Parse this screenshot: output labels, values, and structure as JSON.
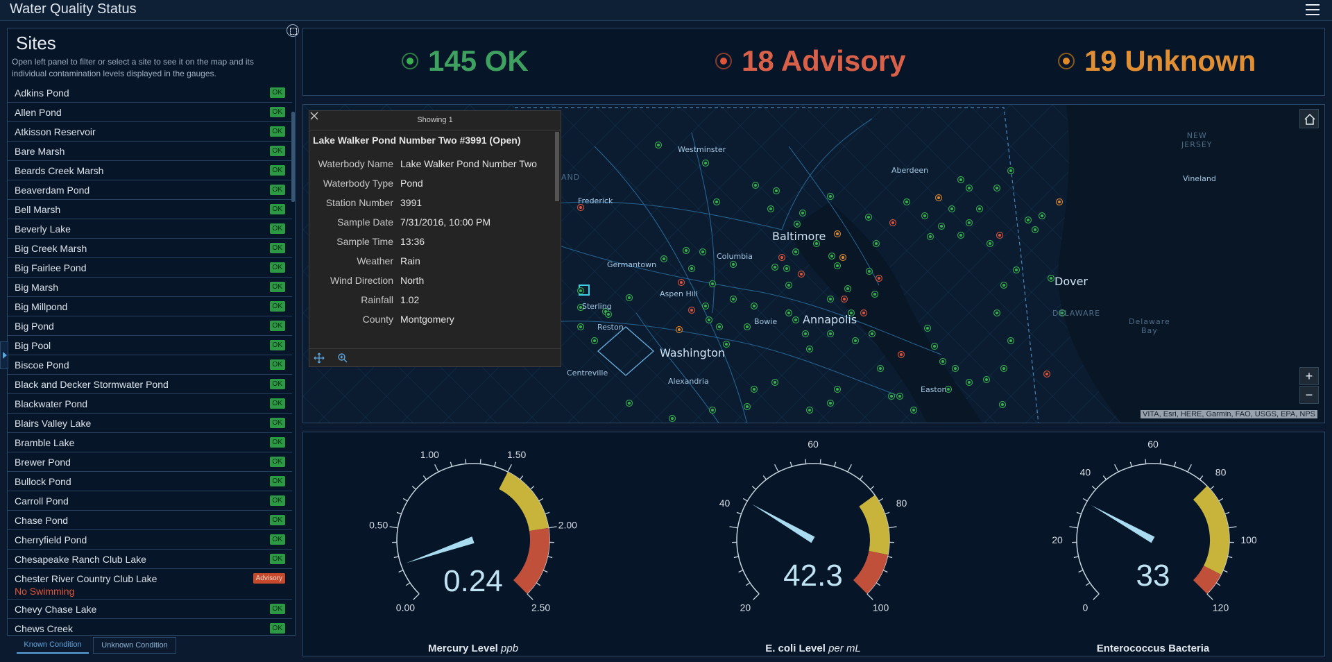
{
  "header": {
    "title": "Water Quality Status"
  },
  "sites": {
    "title": "Sites",
    "description": "Open left panel to filter or select a site to see it on the map and its individual contamination levels displayed in the gauges.",
    "items": [
      {
        "name": "Adkins Pond",
        "status": "OK"
      },
      {
        "name": "Allen Pond",
        "status": "OK"
      },
      {
        "name": "Atkisson Reservoir",
        "status": "OK"
      },
      {
        "name": "Bare Marsh",
        "status": "OK"
      },
      {
        "name": "Beards Creek Marsh",
        "status": "OK"
      },
      {
        "name": "Beaverdam Pond",
        "status": "OK"
      },
      {
        "name": "Bell Marsh",
        "status": "OK"
      },
      {
        "name": "Beverly Lake",
        "status": "OK"
      },
      {
        "name": "Big Creek Marsh",
        "status": "OK"
      },
      {
        "name": "Big Fairlee Pond",
        "status": "OK"
      },
      {
        "name": "Big Marsh",
        "status": "OK"
      },
      {
        "name": "Big Millpond",
        "status": "OK"
      },
      {
        "name": "Big Pond",
        "status": "OK"
      },
      {
        "name": "Big Pool",
        "status": "OK"
      },
      {
        "name": "Biscoe Pond",
        "status": "OK"
      },
      {
        "name": "Black and Decker Stormwater Pond",
        "status": "OK"
      },
      {
        "name": "Blackwater Pond",
        "status": "OK"
      },
      {
        "name": "Blairs Valley Lake",
        "status": "OK"
      },
      {
        "name": "Bramble Lake",
        "status": "OK"
      },
      {
        "name": "Brewer Pond",
        "status": "OK"
      },
      {
        "name": "Bullock Pond",
        "status": "OK"
      },
      {
        "name": "Carroll Pond",
        "status": "OK"
      },
      {
        "name": "Chase Pond",
        "status": "OK"
      },
      {
        "name": "Cherryfield Pond",
        "status": "OK"
      },
      {
        "name": "Chesapeake Ranch Club Lake",
        "status": "OK"
      },
      {
        "name": "Chester River Country Club Lake",
        "status": "Advisory",
        "note": "No Swimming"
      },
      {
        "name": "Chevy Chase Lake",
        "status": "OK"
      },
      {
        "name": "Chews Creek",
        "status": "OK"
      }
    ]
  },
  "tabs": {
    "known": "Known Condition",
    "unknown": "Unknown Condition"
  },
  "indicators": {
    "ok": "145 OK",
    "advisory": "18 Advisory",
    "unknown": "19 Unknown"
  },
  "map": {
    "labels": {
      "westminster": "Westminster",
      "aberdeen": "Aberdeen",
      "new_jersey": "NEW\nJERSEY",
      "vineland": "Vineland",
      "frederick": "Frederick",
      "baltimore": "Baltimore",
      "germantown": "Germantown",
      "columbia": "Columbia",
      "aspen_hill": "Aspen Hill",
      "dover": "Dover",
      "sterling": "Sterling",
      "reston": "Reston",
      "bowie": "Bowie",
      "annapolis": "Annapolis",
      "washington": "Washington",
      "delaware_bay": "Delaware\nBay",
      "delaware": "DELAWARE",
      "centreville": "Centreville",
      "alexandria": "Alexandria",
      "easton": "Easton",
      "and": "AND"
    },
    "attribution": "VITA, Esri, HERE, Garmin, FAO, USGS, EPA, NPS",
    "zoom_in": "+",
    "zoom_out": "−"
  },
  "popup": {
    "header": "Showing 1",
    "title": "Lake Walker Pond Number Two #3991 (Open)",
    "fields": [
      {
        "key": "Waterbody Name",
        "value": "Lake Walker Pond Number Two"
      },
      {
        "key": "Waterbody Type",
        "value": "Pond"
      },
      {
        "key": "Station Number",
        "value": "3991"
      },
      {
        "key": "Sample Date",
        "value": "7/31/2016, 10:00 PM"
      },
      {
        "key": "Sample Time",
        "value": "13:36"
      },
      {
        "key": "Weather",
        "value": "Rain"
      },
      {
        "key": "Wind Direction",
        "value": "North"
      },
      {
        "key": "Rainfall",
        "value": "1.02"
      },
      {
        "key": "County",
        "value": "Montgomery"
      }
    ]
  },
  "gauges": [
    {
      "title": "Mercury Level",
      "unit": "ppb",
      "value": "0.24",
      "min": 0,
      "max": 2.5,
      "v": 0.24,
      "ticks": [
        "0.00",
        "0.50",
        "1.00",
        "1.50",
        "2.00",
        "2.50"
      ],
      "yellow": [
        1.5,
        2.0
      ],
      "red": [
        2.0,
        2.5
      ]
    },
    {
      "title": "E. coli Level",
      "unit": "per mL",
      "value": "42.3",
      "min": 20,
      "max": 100,
      "v": 42.3,
      "ticks": [
        "20",
        "40",
        "60",
        "80",
        "100"
      ],
      "yellow": [
        76,
        90
      ],
      "red": [
        90,
        100
      ]
    },
    {
      "title": "Enterococcus Bacteria",
      "unit": "",
      "value": "33",
      "min": 0,
      "max": 120,
      "v": 33,
      "ticks": [
        "0",
        "20",
        "40",
        "60",
        "80",
        "100",
        "120"
      ],
      "yellow": [
        80,
        112
      ],
      "red": [
        112,
        120
      ]
    }
  ],
  "colors": {
    "ok": "#38b24f",
    "advisory": "#e0563b",
    "unknown": "#e08a2c",
    "gauge_yellow": "#c8b43a",
    "gauge_red": "#c0503a",
    "needle": "#a9dcf0"
  }
}
